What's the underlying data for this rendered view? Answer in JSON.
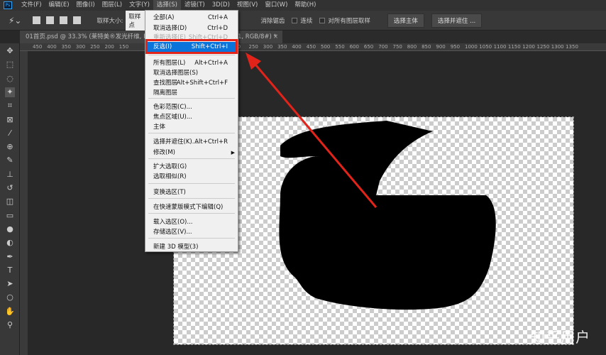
{
  "app": {
    "logo": "Ps"
  },
  "menubar": [
    "文件(F)",
    "编辑(E)",
    "图像(I)",
    "图层(L)",
    "文字(Y)",
    "选择(S)",
    "滤镜(T)",
    "3D(D)",
    "视图(V)",
    "窗口(W)",
    "帮助(H)"
  ],
  "options": {
    "sample_size_label": "取样大小:",
    "sample_size_value": "取样点",
    "antialias": "消除锯齿",
    "contiguous": "连续",
    "sample_all": "对所有图层取样",
    "select_subject": "选择主体",
    "select_mask": "选择并遮住 ..."
  },
  "tab": {
    "title": "01首页.psd @ 33.3% (莱特美®发光纤维, RGB/",
    "title_end": "1, RGB/8#) *",
    "close": "×"
  },
  "ruler": [
    "450",
    "400",
    "350",
    "300",
    "250",
    "200",
    "150",
    "",
    "",
    "",
    "",
    "",
    "",
    "",
    "00",
    "250",
    "300",
    "350",
    "400",
    "450",
    "500",
    "550",
    "600",
    "650",
    "700",
    "750",
    "800",
    "850",
    "900",
    "950",
    "1000",
    "1050",
    "1100",
    "1150",
    "1200",
    "1250",
    "1300",
    "1350"
  ],
  "menu": [
    {
      "label": "全部(A)",
      "shortcut": "Ctrl+A"
    },
    {
      "label": "取消选择(D)",
      "shortcut": "Ctrl+D"
    },
    {
      "label": "重新选择(E)",
      "shortcut": "Shift+Ctrl+D",
      "disabled": true
    },
    {
      "label": "反选(I)",
      "shortcut": "Shift+Ctrl+I",
      "highlighted": true
    },
    {
      "label": "所有图层(L)",
      "shortcut": "Alt+Ctrl+A"
    },
    {
      "label": "取消选择图层(S)",
      "shortcut": ""
    },
    {
      "label": "查找图层",
      "shortcut": "Alt+Shift+Ctrl+F"
    },
    {
      "label": "隔离图层",
      "shortcut": ""
    },
    {
      "label": "色彩范围(C)...",
      "shortcut": ""
    },
    {
      "label": "焦点区域(U)...",
      "shortcut": ""
    },
    {
      "label": "主体",
      "shortcut": ""
    },
    {
      "label": "选择并遮住(K)...",
      "shortcut": "Alt+Ctrl+R"
    },
    {
      "label": "修改(M)",
      "shortcut": "",
      "submenu": "▶"
    },
    {
      "label": "扩大选取(G)",
      "shortcut": ""
    },
    {
      "label": "选取相似(R)",
      "shortcut": ""
    },
    {
      "label": "变换选区(T)",
      "shortcut": ""
    },
    {
      "label": "在快速蒙版模式下编辑(Q)",
      "shortcut": ""
    },
    {
      "label": "载入选区(O)...",
      "shortcut": ""
    },
    {
      "label": "存储选区(V)...",
      "shortcut": ""
    },
    {
      "label": "新建 3D 模型(3)",
      "shortcut": ""
    }
  ],
  "watermark": "知乎用户",
  "colors": {
    "highlight": "#0a74da",
    "annotation": "#e2231a"
  }
}
